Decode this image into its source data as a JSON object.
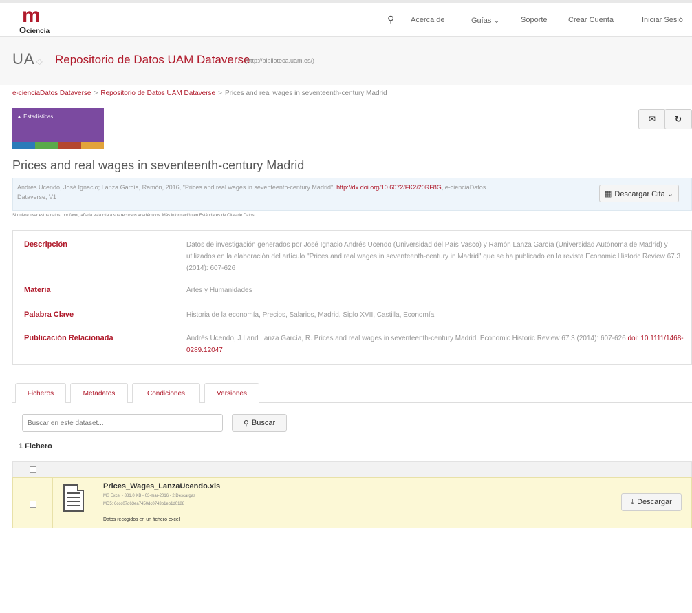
{
  "nav": {
    "logo_text": "ciencia",
    "items": [
      "Acerca de",
      "Guías ⌄",
      "Soporte",
      "Crear Cuenta",
      "Iniciar Sesió"
    ]
  },
  "banner": {
    "logo": "UA",
    "title": "Repositorio de Datos UAM Dataverse",
    "url": "(http://biblioteca.uam.es/)"
  },
  "breadcrumb": {
    "items": [
      "e-cienciaDatos Dataverse",
      "Repositorio de Datos UAM Dataverse",
      "Prices and real wages in seventeenth-century Madrid"
    ],
    "separator": ">"
  },
  "stats": {
    "label": "Estadísticas",
    "strip_colors": [
      "#2b7bb9",
      "#5aaa4a",
      "#b4462e",
      "#e2a33a"
    ]
  },
  "dataset": {
    "title": "Prices and real wages in seventeenth-century Madrid",
    "citation_text": "Andrés Ucendo, José Ignacio; Lanza García, Ramón, 2016, \"Prices and real wages in seventeenth-century Madrid\",",
    "citation_doi": "http://dx.doi.org/10.6072/FK2/20RF8G",
    "citation_tail": ", e-cienciaDatos Dataverse, V1",
    "cite_button": "Descargar Cita ⌄",
    "citation_note": "Si quiere usar estos datos, por favor, añada esta cita a sus recursos académicos. Más información en Estándares de Citas de Datos."
  },
  "metadata": [
    {
      "label": "Descripción",
      "value": "Datos de investigación generados por José Ignacio Andrés Ucendo (Universidad del País Vasco) y Ramón Lanza García (Universidad Autónoma de Madrid) y utilizados en la elaboración del artículo \"Prices and real wages in seventeenth-century in Madrid\" que se ha publicado en la revista Economic Historic Review 67.3 (2014): 607-626"
    },
    {
      "label": "Materia",
      "value": "Artes y Humanidades"
    },
    {
      "label": "Palabra Clave",
      "value": "Historia de la economía, Precios, Salarios, Madrid, Siglo XVII, Castilla, Economía"
    },
    {
      "label": "Publicación Relacionada",
      "value": "Andrés Ucendo, J.I.and Lanza García, R. Prices and real wages in seventeenth-century Madrid. Economic Historic Review 67.3 (2014): 607-626",
      "doi": "doi: 10.1111/1468-0289.12047"
    }
  ],
  "tabs": [
    "Ficheros",
    "Metadatos",
    "Condiciones",
    "Versiones"
  ],
  "search": {
    "placeholder": "Buscar en este dataset...",
    "button": "Buscar"
  },
  "files": {
    "count": "1 Fichero",
    "items": [
      {
        "name": "Prices_Wages_LanzaUcendo.xls",
        "meta1": "MS Excel - 881.0 KB - 03-mar-2016 - 2 Descargas",
        "meta2": "MD5: 6ccc07d63ea7450dc0743b1eb1d0188",
        "description": "Datos recogidos en un fichero excel",
        "download": "Descargar"
      }
    ]
  }
}
